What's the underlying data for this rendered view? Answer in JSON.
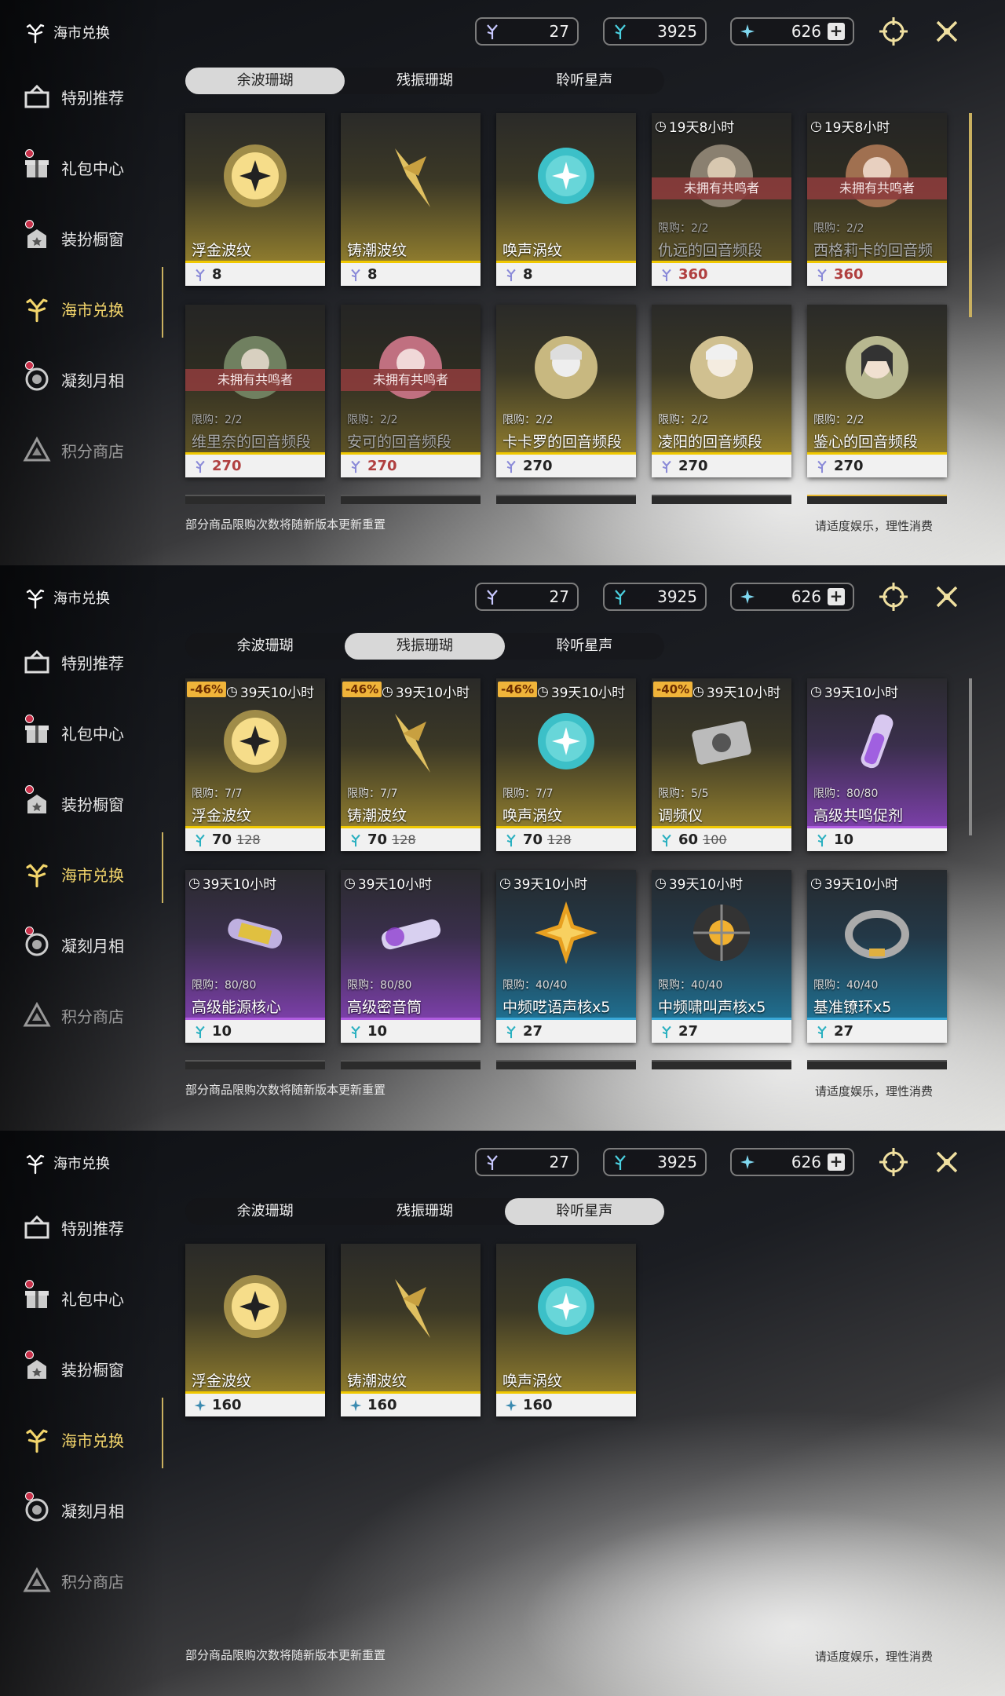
{
  "title": "海市兑换",
  "currencies": {
    "a": "27",
    "b": "3925",
    "c": "626",
    "plus": "+"
  },
  "nav": [
    "特别推荐",
    "礼包中心",
    "装扮橱窗",
    "海市兑换",
    "凝刻月相",
    "积分商店"
  ],
  "tabs": [
    "余波珊瑚",
    "残振珊瑚",
    "聆听星声"
  ],
  "footer_left": "部分商品限购次数将随新版本更新重置",
  "footer_right": "请适度娱乐，理性消费",
  "panel1": {
    "items": [
      {
        "name": "浮金波纹",
        "price": "8"
      },
      {
        "name": "铸潮波纹",
        "price": "8"
      },
      {
        "name": "唤声涡纹",
        "price": "8"
      },
      {
        "name": "仇远的回音频段",
        "price": "360",
        "limit": "限购：2/2",
        "timer": "19天8小时",
        "locked": "未拥有共鸣者"
      },
      {
        "name": "西格莉卡的回音频段",
        "price": "360",
        "limit": "限购：2/2",
        "timer": "19天8小时",
        "locked": "未拥有共鸣者"
      },
      {
        "name": "维里奈的回音频段",
        "price": "270",
        "limit": "限购：2/2",
        "locked": "未拥有共鸣者"
      },
      {
        "name": "安可的回音频段",
        "price": "270",
        "limit": "限购：2/2",
        "locked": "未拥有共鸣者"
      },
      {
        "name": "卡卡罗的回音频段",
        "price": "270",
        "limit": "限购：2/2"
      },
      {
        "name": "凌阳的回音频段",
        "price": "270",
        "limit": "限购：2/2"
      },
      {
        "name": "鉴心的回音频段",
        "price": "270",
        "limit": "限购：2/2"
      }
    ]
  },
  "panel2": {
    "items": [
      {
        "name": "浮金波纹",
        "price": "70",
        "old": "128",
        "limit": "限购：7/7",
        "timer": "39天10小时",
        "disc": "-46%"
      },
      {
        "name": "铸潮波纹",
        "price": "70",
        "old": "128",
        "limit": "限购：7/7",
        "timer": "39天10小时",
        "disc": "-46%"
      },
      {
        "name": "唤声涡纹",
        "price": "70",
        "old": "128",
        "limit": "限购：7/7",
        "timer": "39天10小时",
        "disc": "-46%"
      },
      {
        "name": "调频仪",
        "price": "60",
        "old": "100",
        "limit": "限购：5/5",
        "timer": "39天10小时",
        "disc": "-40%"
      },
      {
        "name": "高级共鸣促剂",
        "price": "10",
        "limit": "限购：80/80",
        "timer": "39天10小时"
      },
      {
        "name": "高级能源核心",
        "price": "10",
        "limit": "限购：80/80",
        "timer": "39天10小时"
      },
      {
        "name": "高级密音筒",
        "price": "10",
        "limit": "限购：80/80",
        "timer": "39天10小时"
      },
      {
        "name": "中频呓语声核x5",
        "price": "27",
        "limit": "限购：40/40",
        "timer": "39天10小时"
      },
      {
        "name": "中频啸叫声核x5",
        "price": "27",
        "limit": "限购：40/40",
        "timer": "39天10小时"
      },
      {
        "name": "基准镣环x5",
        "price": "27",
        "limit": "限购：40/40",
        "timer": "39天10小时"
      }
    ]
  },
  "panel3": {
    "items": [
      {
        "name": "浮金波纹",
        "price": "160"
      },
      {
        "name": "铸潮波纹",
        "price": "160"
      },
      {
        "name": "唤声涡纹",
        "price": "160"
      }
    ]
  },
  "colors": {
    "accent": "#f3d56b",
    "gold": "#f0c800",
    "purple": "#b05de0",
    "teal": "#3aa8d8",
    "discount": "#f0b43a",
    "locked": "#8c3c3c"
  },
  "icons": [
    "coral-icon",
    "coral-blue-icon",
    "star-icon",
    "shop-target-icon",
    "close-icon",
    "gift-icon",
    "hanger-icon",
    "moon-icon",
    "triangle-icon",
    "clock-icon"
  ]
}
